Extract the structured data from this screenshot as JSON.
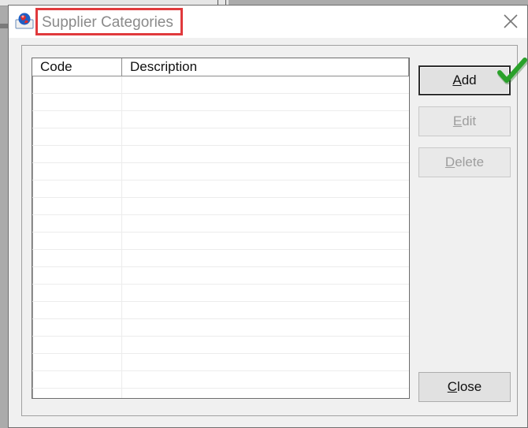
{
  "window": {
    "title": "Supplier Categories"
  },
  "listview": {
    "columns": [
      {
        "label": "Code"
      },
      {
        "label": "Description"
      }
    ],
    "rows": []
  },
  "buttons": {
    "add": {
      "label": "Add",
      "mnemonic": "A",
      "enabled": true
    },
    "edit": {
      "label": "Edit",
      "mnemonic": "E",
      "enabled": false
    },
    "delete": {
      "label": "Delete",
      "mnemonic": "D",
      "enabled": false
    },
    "close": {
      "label": "Close",
      "mnemonic": "C",
      "enabled": true
    }
  },
  "icons": {
    "app": "app-globe-icon",
    "close": "close-icon",
    "check": "green-checkmark-icon"
  },
  "colors": {
    "highlight": "#e0393c",
    "check": "#2aa12a"
  }
}
